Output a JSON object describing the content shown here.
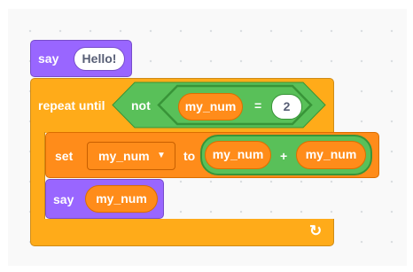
{
  "script": {
    "say_block": {
      "keyword": "say",
      "message": "Hello!"
    },
    "repeat_until_block": {
      "keyword": "repeat until",
      "condition": {
        "not_keyword": "not",
        "equals": {
          "left": "my_num",
          "operator": "=",
          "right": "2"
        }
      },
      "loop_arrow": "↻"
    },
    "set_block": {
      "keyword": "set",
      "variable": "my_num",
      "dropdown_arrow": "▼",
      "to_keyword": "to",
      "add": {
        "left": "my_num",
        "operator": "+",
        "right": "my_num"
      }
    },
    "say_var_block": {
      "keyword": "say",
      "reporter": "my_num"
    }
  },
  "colors": {
    "looks": "#9966ff",
    "control": "#ffab19",
    "operators": "#59c059",
    "variables": "#ff8c1a"
  }
}
